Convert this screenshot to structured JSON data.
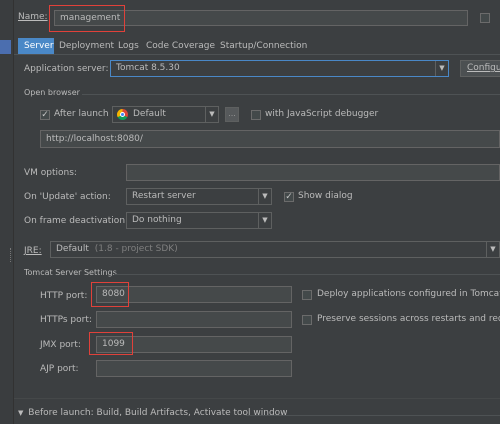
{
  "name": {
    "label": "Name:",
    "value": "management"
  },
  "tabs": [
    {
      "label": "Server"
    },
    {
      "label": "Deployment"
    },
    {
      "label": "Logs"
    },
    {
      "label": "Code Coverage"
    },
    {
      "label": "Startup/Connection"
    }
  ],
  "app_server": {
    "label": "Application server:",
    "value": "Tomcat 8.5.30",
    "configure_label": "Configu"
  },
  "open_browser": {
    "section_label": "Open browser",
    "after_launch_label": "After launch",
    "after_launch_checked": true,
    "browser_value": "Default",
    "more_label": "...",
    "js_debugger_label": "with JavaScript debugger",
    "url": "http://localhost:8080/"
  },
  "vm_options": {
    "label": "VM options:",
    "value": ""
  },
  "on_update": {
    "label": "On 'Update' action:",
    "value": "Restart server",
    "show_dialog_label": "Show dialog",
    "show_dialog_checked": true
  },
  "on_frame": {
    "label": "On frame deactivation:",
    "value": "Do nothing"
  },
  "jre": {
    "label": "JRE:",
    "value": "Default",
    "hint": "(1.8 - project SDK)"
  },
  "tomcat_settings": {
    "section_label": "Tomcat Server Settings",
    "http_port_label": "HTTP port:",
    "http_port": "8080",
    "https_port_label": "HTTPs port:",
    "https_port": "",
    "jmx_port_label": "JMX port:",
    "jmx_port": "1099",
    "ajp_port_label": "AJP port:",
    "ajp_port": "",
    "deploy_label": "Deploy applications configured in Tomcat in",
    "preserve_label": "Preserve sessions across restarts and redep"
  },
  "before_launch": {
    "label": "Before launch: Build, Build Artifacts, Activate tool window"
  },
  "colors": {
    "accent": "#4a88c7",
    "highlight": "#e0413a",
    "background": "#3c3f41"
  }
}
